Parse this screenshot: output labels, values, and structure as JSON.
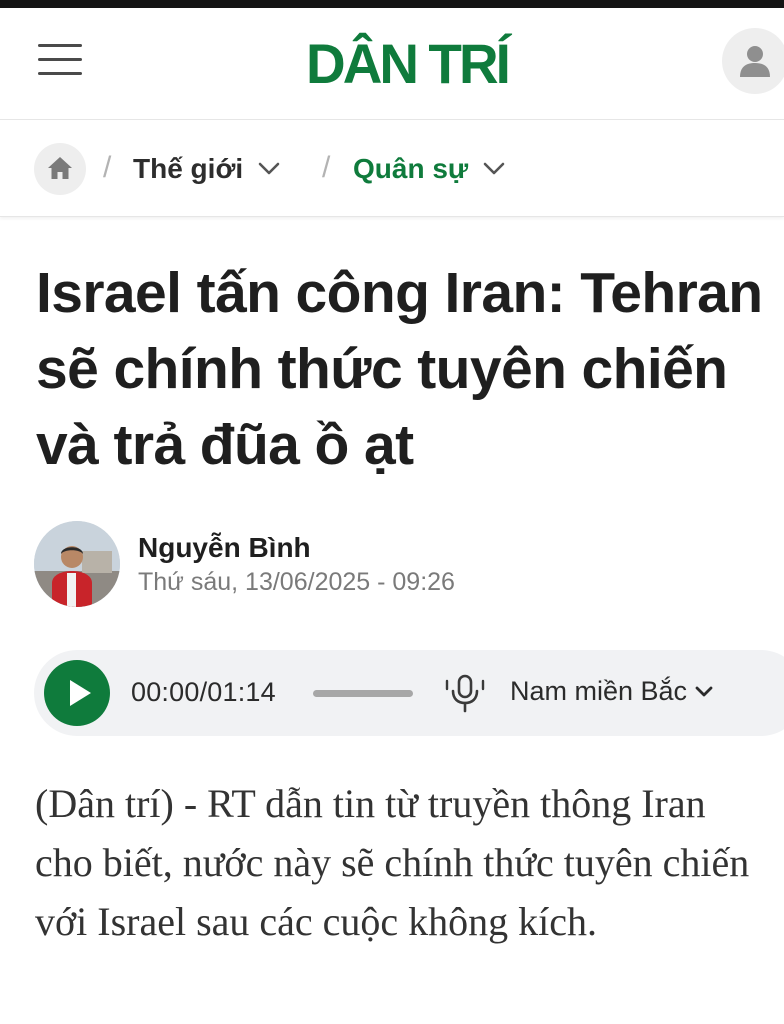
{
  "header": {
    "logo_text": "DÂN TRÍ",
    "brand_color": "#0f7b3c",
    "menu_icon": "hamburger-menu-icon",
    "account_icon": "user-icon"
  },
  "breadcrumb": {
    "home_icon": "home-icon",
    "items": [
      {
        "label": "Thế giới",
        "color": "#2d2d2d"
      },
      {
        "label": "Quân sự",
        "color": "#0f7b3c"
      }
    ]
  },
  "article": {
    "title": "Israel tấn công Iran: Tehran sẽ chính thức tuyên chiến và trả đũa ồ ạt",
    "author": {
      "name": "Nguyễn Bình",
      "date": "Thứ sáu, 13/06/2025 - 09:26"
    },
    "lead": "(Dân trí) - RT dẫn tin từ truyền thông Iran cho biết, nước này sẽ chính thức tuyên chiến với Israel sau các cuộc không kích."
  },
  "audio_player": {
    "time": "00:00/01:14",
    "progress": 0,
    "voice": "Nam miền Bắc",
    "play_icon": "play-icon",
    "voice_icon": "microphone-icon"
  }
}
